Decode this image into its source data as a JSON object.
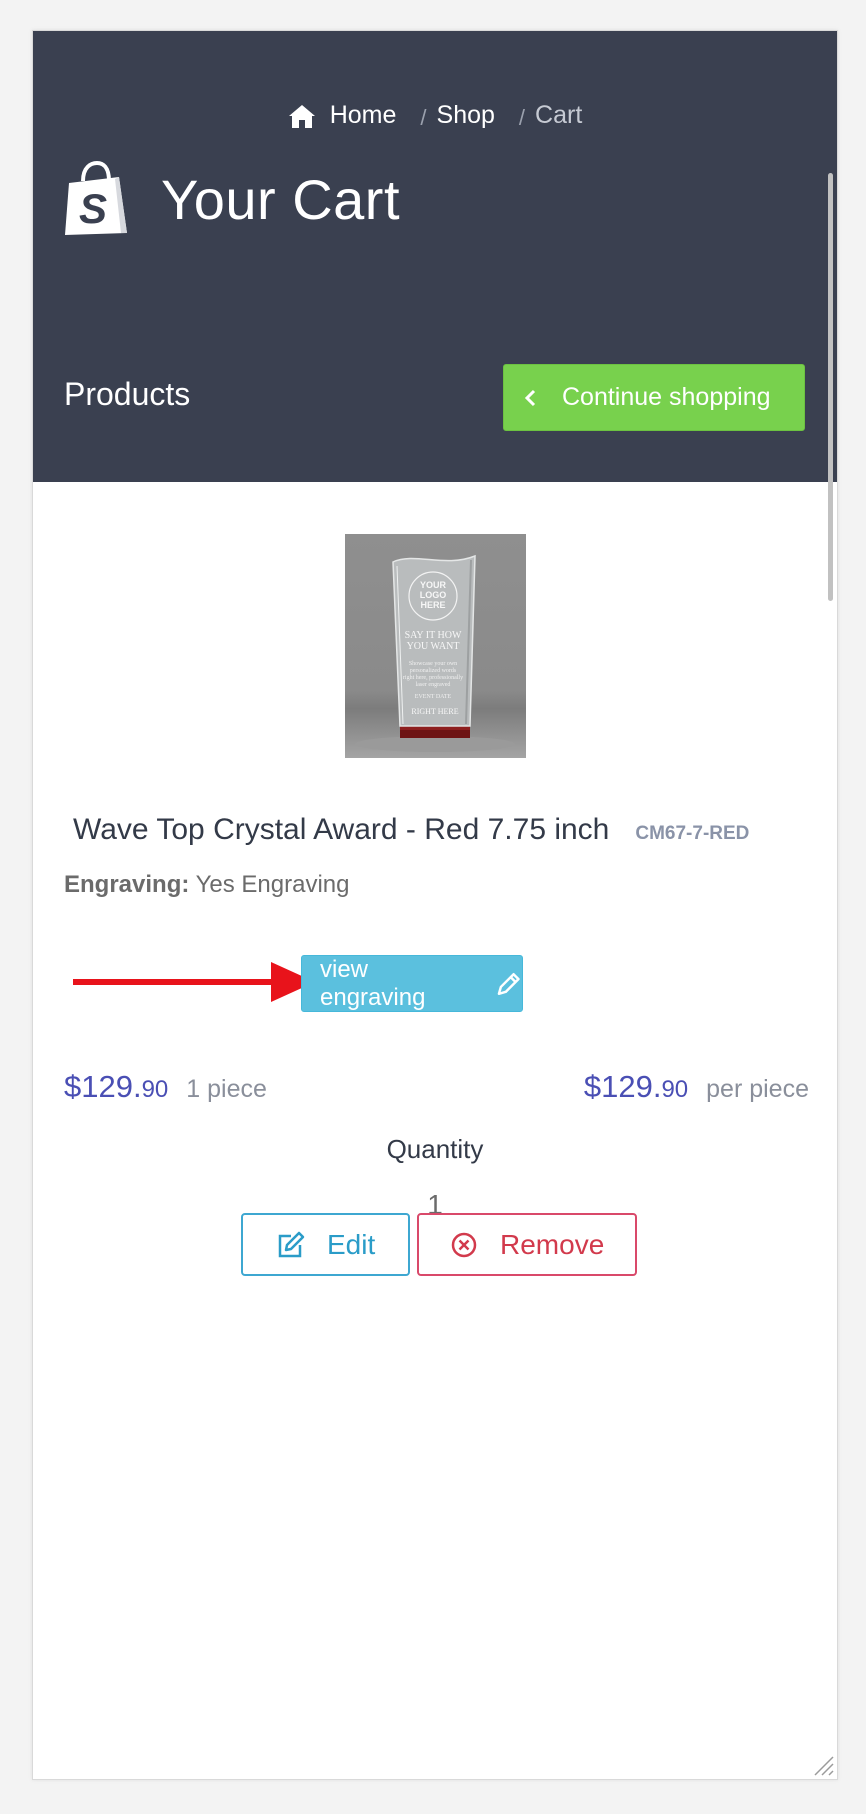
{
  "breadcrumb": {
    "home": "Home",
    "shop": "Shop",
    "current": "Cart",
    "separator": "/"
  },
  "header": {
    "title": "Your Cart",
    "products_label": "Products",
    "continue_label": "Continue shopping"
  },
  "product": {
    "name": "Wave Top Crystal Award - Red 7.75 inch",
    "sku": "CM67-7-RED",
    "engraving_label": "Engraving:",
    "engraving_value": "Yes Engraving",
    "view_engraving_label": "view engraving",
    "image_text": {
      "logo": [
        "YOUR",
        "LOGO",
        "HERE"
      ],
      "headline": [
        "SAY IT HOW",
        "YOU WANT"
      ],
      "body": [
        "Showcase your own",
        "personalized words",
        "right here, professionally",
        "laser engraved"
      ],
      "event": "EVENT DATE",
      "footer": "RIGHT HERE"
    },
    "total_price_main": "$129.",
    "total_price_cents": "90",
    "total_note": "1 piece",
    "unit_price_main": "$129.",
    "unit_price_cents": "90",
    "unit_note": "per piece",
    "quantity_label": "Quantity",
    "quantity_value": "1",
    "edit_label": "Edit",
    "remove_label": "Remove"
  },
  "colors": {
    "header_bg": "#3a4050",
    "continue_btn": "#78d14d",
    "view_btn": "#5bc0de",
    "price": "#4a4fb4",
    "edit": "#2a9cc8",
    "remove": "#d23a4c",
    "arrow": "#e8131b"
  },
  "icons": [
    "home-icon",
    "shopping-bag-icon",
    "chevron-left-icon",
    "pencil-icon",
    "edit-icon",
    "remove-circle-icon",
    "arrow-annotation"
  ]
}
